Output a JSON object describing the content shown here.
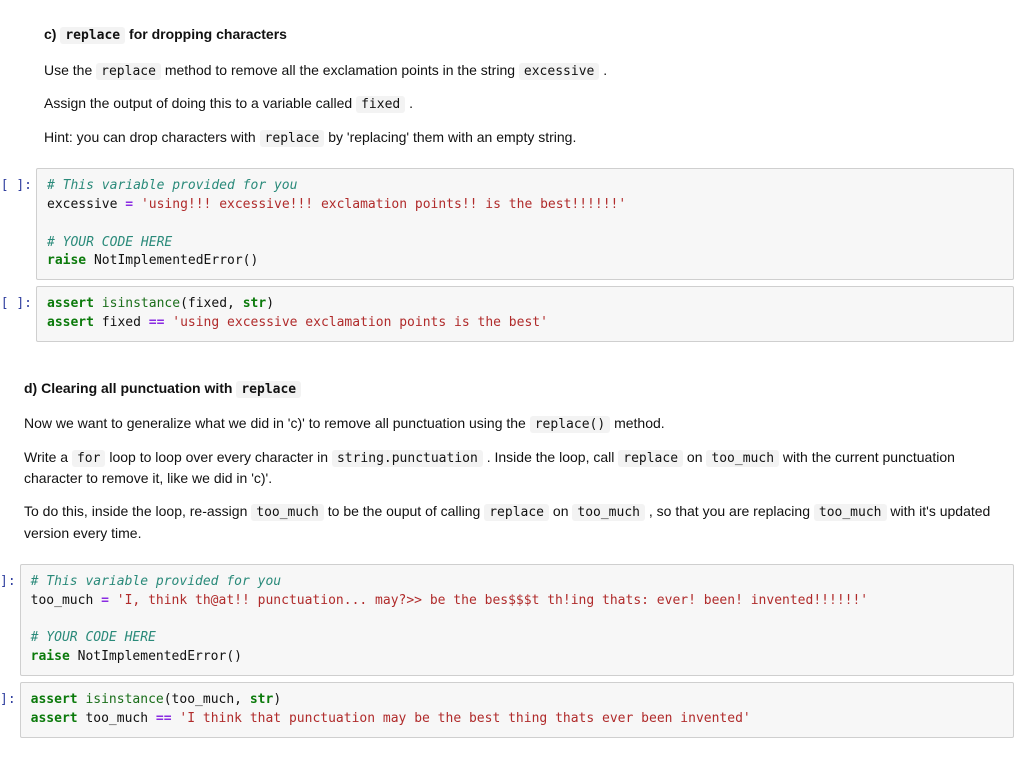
{
  "prompts": {
    "empty": "[ ]:",
    "cut": "]:"
  },
  "section_c": {
    "heading_pre": "c) ",
    "heading_code": "replace",
    "heading_post": " for dropping characters",
    "p1_a": "Use the ",
    "p1_c1": "replace",
    "p1_b": " method to remove all the exclamation points in the string ",
    "p1_c2": "excessive",
    "p1_c": " .",
    "p2_a": "Assign the output of doing this to a variable called ",
    "p2_c1": "fixed",
    "p2_b": " .",
    "p3_a": "Hint: you can drop characters with ",
    "p3_c1": "replace",
    "p3_b": " by 'replacing' them with an empty string."
  },
  "code_c1": {
    "l1": "# This variable provided for you",
    "l2_a": "excessive ",
    "l2_op": "=",
    "l2_b": " ",
    "l2_str": "'using!!! excessive!!! exclamation points!! is the best!!!!!!'",
    "l3": "",
    "l4": "# YOUR CODE HERE",
    "l5_a": "raise",
    "l5_b": " NotImplementedError()"
  },
  "code_c2": {
    "l1_a": "assert",
    "l1_b": " ",
    "l1_fn": "isinstance",
    "l1_c": "(fixed, ",
    "l1_kw2": "str",
    "l1_d": ")",
    "l2_a": "assert",
    "l2_b": " fixed ",
    "l2_op": "==",
    "l2_c": " ",
    "l2_str": "'using excessive exclamation points is the best'"
  },
  "section_d": {
    "heading_pre": "d) Clearing all punctuation with ",
    "heading_code": "replace",
    "p1_a": "Now we want to generalize what we did in 'c)' to remove all punctuation using the ",
    "p1_c1": "replace()",
    "p1_b": " method.",
    "p2_a": "Write a ",
    "p2_c1": "for",
    "p2_b": " loop to loop over every character in ",
    "p2_c2": "string.punctuation",
    "p2_c": " . Inside the loop, call ",
    "p2_c3": "replace",
    "p2_d": " on ",
    "p2_c4": "too_much",
    "p2_e": " with the current punctuation character to remove it, like we did in 'c)'.",
    "p3_a": "To do this, inside the loop, re-assign ",
    "p3_c1": "too_much",
    "p3_b": " to be the ouput of calling ",
    "p3_c2": "replace",
    "p3_c": " on ",
    "p3_c3": "too_much",
    "p3_d": " , so that you are replacing ",
    "p3_c4": "too_much",
    "p3_e": " with it's updated version every time."
  },
  "code_d1": {
    "l1": "# This variable provided for you",
    "l2_a": "too_much ",
    "l2_op": "=",
    "l2_b": " ",
    "l2_str": "'I, think th@at!! punctuation... may?>> be the bes$$$t th!ing thats: ever! been! invented!!!!!!'",
    "l3": "",
    "l4": "# YOUR CODE HERE",
    "l5_a": "raise",
    "l5_b": " NotImplementedError()"
  },
  "code_d2": {
    "l1_a": "assert",
    "l1_b": " ",
    "l1_fn": "isinstance",
    "l1_c": "(too_much, ",
    "l1_kw2": "str",
    "l1_d": ")",
    "l2_a": "assert",
    "l2_b": " too_much ",
    "l2_op": "==",
    "l2_c": " ",
    "l2_str": "'I think that punctuation may be the best thing thats ever been invented'"
  }
}
